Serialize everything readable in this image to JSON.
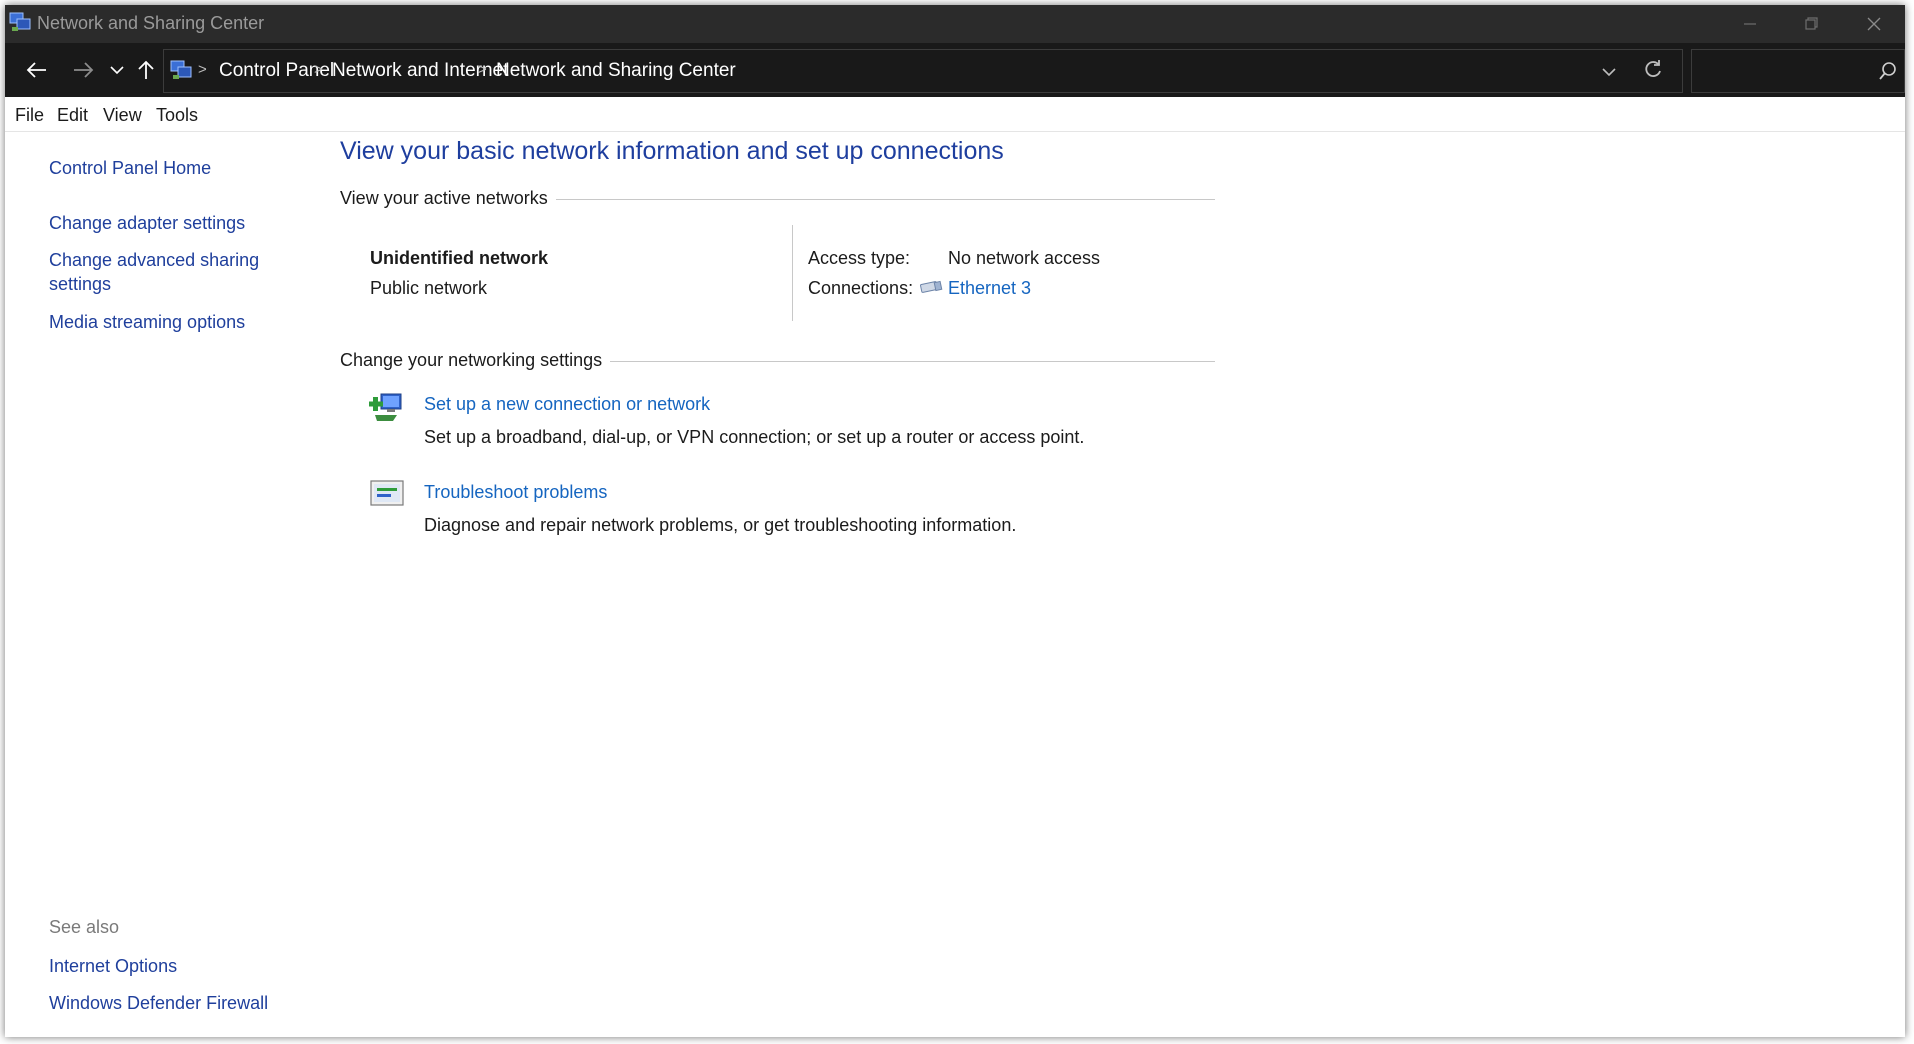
{
  "window": {
    "title": "Network and Sharing Center"
  },
  "address_bar": {
    "breadcrumbs": [
      "Control Panel",
      "Network and Internet",
      "Network and Sharing Center"
    ],
    "search_placeholder": ""
  },
  "menu": [
    "File",
    "Edit",
    "View",
    "Tools"
  ],
  "left_pane": {
    "home": "Control Panel Home",
    "links": [
      "Change adapter settings",
      "Change advanced sharing settings",
      "Media streaming options"
    ],
    "see_also_label": "See also",
    "see_also_links": [
      "Internet Options",
      "Windows Defender Firewall"
    ]
  },
  "main": {
    "title": "View your basic network information and set up connections",
    "active_networks_label": "View your active networks",
    "network": {
      "name": "Unidentified network",
      "type": "Public network",
      "access_type_label": "Access type:",
      "access_type_value": "No network access",
      "connections_label": "Connections:",
      "connections_value": "Ethernet 3"
    },
    "change_settings_label": "Change your networking settings",
    "tasks": [
      {
        "title": "Set up a new connection or network",
        "description": "Set up a broadband, dial-up, or VPN connection; or set up a router or access point."
      },
      {
        "title": "Troubleshoot problems",
        "description": "Diagnose and repair network problems, or get troubleshooting information."
      }
    ]
  },
  "colors": {
    "titlebar_bg": "#2b2b2b",
    "addressbar_bg": "#191919",
    "title_blue": "#1e3e9e",
    "link_blue": "#1565c0",
    "nav_link": "#1f3f9c"
  }
}
